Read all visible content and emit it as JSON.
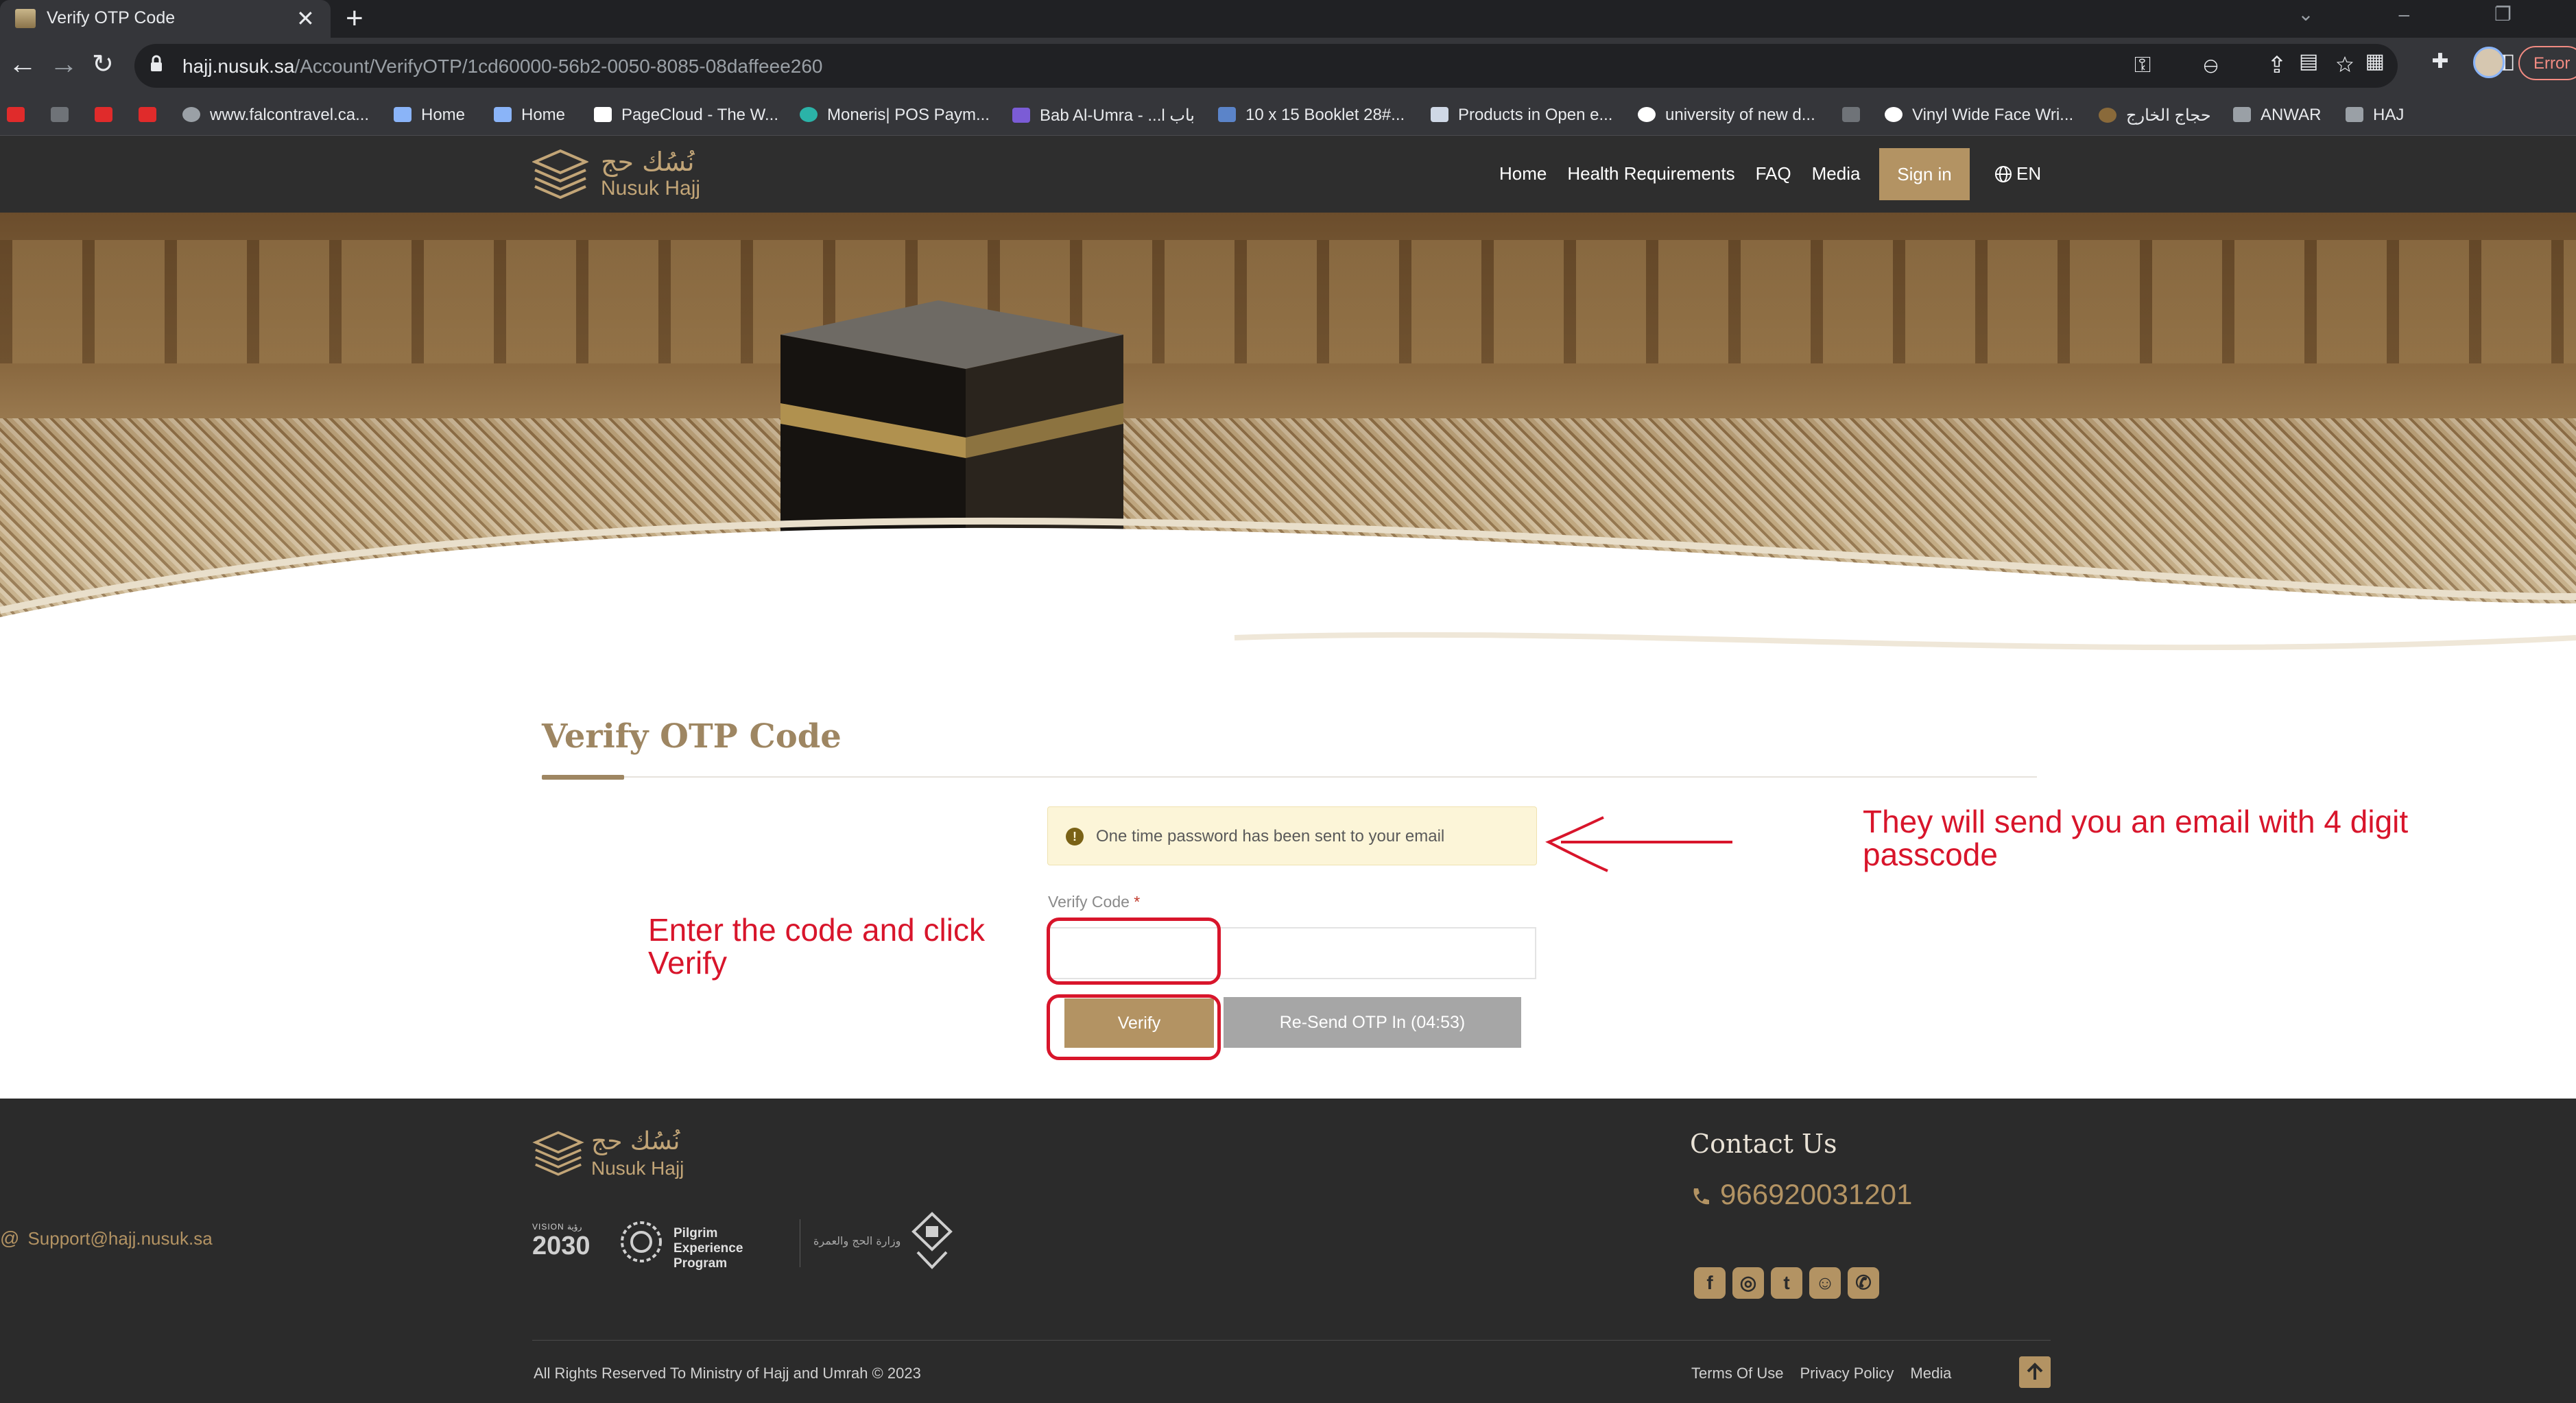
{
  "browser": {
    "tab_title": "Verify OTP Code",
    "tab_close": "✕",
    "new_tab": "+",
    "url_host": "hajj.nusuk.sa",
    "url_path": "/Account/VerifyOTP/1cd60000-56b2-0050-8085-08daffeee260",
    "error_label": "Error",
    "bookmarks": [
      "www.falcontravel.ca...",
      "Home",
      "Home",
      "PageCloud - The W...",
      "Moneris| POS Paym...",
      "Bab Al-Umra - ...l باب",
      "10 x 15 Booklet 28#...",
      "Products in Open e...",
      "university of new d...",
      "Vinyl Wide Face Wri...",
      "حجاج الخارج",
      "ANWAR",
      "HAJ"
    ]
  },
  "site": {
    "logo_ar": "نُسُك حج",
    "logo_en": "Nusuk Hajj",
    "nav": [
      "Home",
      "Health Requirements",
      "FAQ",
      "Media"
    ],
    "signin": "Sign in",
    "lang": "EN"
  },
  "main": {
    "page_title": "Verify OTP Code",
    "alert_icon": "!",
    "alert": "One time password has been sent to your email",
    "field_label": "Verify Code",
    "field_required": "*",
    "code_value": "",
    "verify_button": "Verify",
    "resend_button": "Re-Send OTP In (04:53)"
  },
  "annotations": {
    "left_line1": "Enter the code and click",
    "left_line2": "Verify",
    "right_line1": "They will send you an email with 4 digit",
    "right_line2": "passcode",
    "color": "#d8152b"
  },
  "footer": {
    "logo_ar": "نُسُك حج",
    "logo_en": "Nusuk Hajj",
    "vision_top": "VISION رؤية",
    "vision_year": "2030",
    "pep_line1": "Pilgrim Experience",
    "pep_line2": "Program",
    "ministry_text": "وزارة الحج والعمرة",
    "contact_title": "Contact Us",
    "phone": "966920031201",
    "email": "Support@hajj.nusuk.sa",
    "copyright": "All Rights Reserved To Ministry of Hajj and Umrah © 2023",
    "links": [
      "Terms Of Use",
      "Privacy Policy",
      "Media"
    ]
  },
  "colors": {
    "brand_gold": "#b39363",
    "header_bg": "#2e2e2e",
    "footer_bg": "#2b2b2b",
    "resend_gray": "#a6a6a6",
    "alert_bg": "#fcf5d8"
  }
}
